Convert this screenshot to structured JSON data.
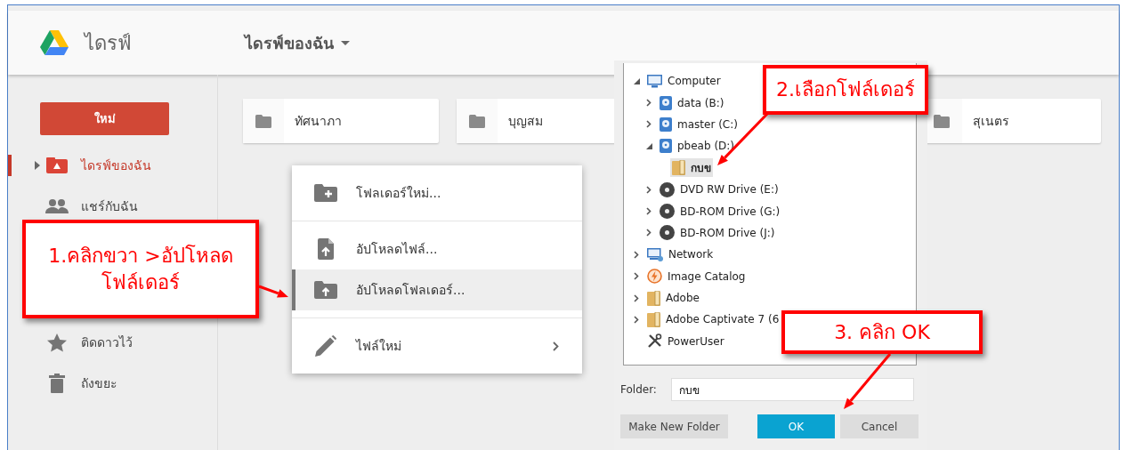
{
  "header": {
    "app_name": "ไดรฟ์",
    "location": "ไดรฟ์ของฉัน"
  },
  "sidebar": {
    "new_button": "ใหม่",
    "items": [
      {
        "label": "ไดรฟ์ของฉัน",
        "kind": "drive",
        "selected": true
      },
      {
        "label": "แชร์กับฉัน",
        "kind": "shared",
        "selected": false
      },
      {
        "label": "ติดดาวไว้",
        "kind": "star",
        "selected": false
      },
      {
        "label": "ถังขยะ",
        "kind": "trash",
        "selected": false
      }
    ]
  },
  "folders": [
    {
      "name": "ทัศนาภา"
    },
    {
      "name": "บุญสม"
    },
    {
      "name": "สุเนตร"
    }
  ],
  "context_menu": [
    {
      "label": "โฟลเดอร์ใหม่...",
      "kind": "newfolder",
      "selected": false,
      "submenu": false
    },
    {
      "label": "อัปโหลดไฟล์...",
      "kind": "uploadfile",
      "selected": false,
      "submenu": false
    },
    {
      "label": "อัปโหลดโฟลเดอร์...",
      "kind": "uploadfolder",
      "selected": true,
      "submenu": false
    },
    {
      "label": "ไฟล์ใหม่",
      "kind": "newfile",
      "selected": false,
      "submenu": true
    }
  ],
  "folder_dialog": {
    "tree": [
      {
        "label": "Computer",
        "kind": "computer",
        "has_children": true,
        "expanded": true,
        "selected": false,
        "children": [
          {
            "label": "data (B:)",
            "kind": "drive",
            "has_children": true,
            "expanded": false,
            "selected": false
          },
          {
            "label": "master (C:)",
            "kind": "drive",
            "has_children": true,
            "expanded": false,
            "selected": false
          },
          {
            "label": "pbeab (D:)",
            "kind": "drive",
            "has_children": true,
            "expanded": true,
            "selected": false,
            "children": [
              {
                "label": "กบข",
                "kind": "folder",
                "selected": true
              }
            ]
          },
          {
            "label": "DVD RW Drive (E:)",
            "kind": "disc",
            "has_children": true,
            "expanded": false,
            "selected": false
          },
          {
            "label": "BD-ROM Drive (G:)",
            "kind": "disc",
            "has_children": true,
            "expanded": false,
            "selected": false
          },
          {
            "label": "BD-ROM Drive (J:)",
            "kind": "disc",
            "has_children": true,
            "expanded": false,
            "selected": false
          }
        ]
      },
      {
        "label": "Network",
        "kind": "network",
        "has_children": true,
        "expanded": false,
        "selected": false
      },
      {
        "label": "Image Catalog",
        "kind": "catalog",
        "has_children": true,
        "expanded": false,
        "selected": false
      },
      {
        "label": "Adobe",
        "kind": "folder",
        "has_children": true,
        "expanded": false,
        "selected": false
      },
      {
        "label": "Adobe Captivate 7 (6",
        "kind": "folder",
        "has_children": true,
        "expanded": false,
        "selected": false
      },
      {
        "label": "PowerUser",
        "kind": "tools",
        "selected": false
      }
    ],
    "folder_label": "Folder:",
    "folder_value": "กบข",
    "buttons": [
      {
        "label": "Make New Folder",
        "kind": "plain"
      },
      {
        "label": "OK",
        "kind": "primary"
      },
      {
        "label": "Cancel",
        "kind": "plain"
      }
    ]
  },
  "callouts": [
    {
      "lines": [
        "1.คลิกขวา >อัปโหลด",
        "โฟล์เดอร์"
      ]
    },
    {
      "lines": [
        "2.เลือกโฟล์เดอร์"
      ]
    },
    {
      "lines": [
        "3. คลิก OK"
      ]
    }
  ]
}
